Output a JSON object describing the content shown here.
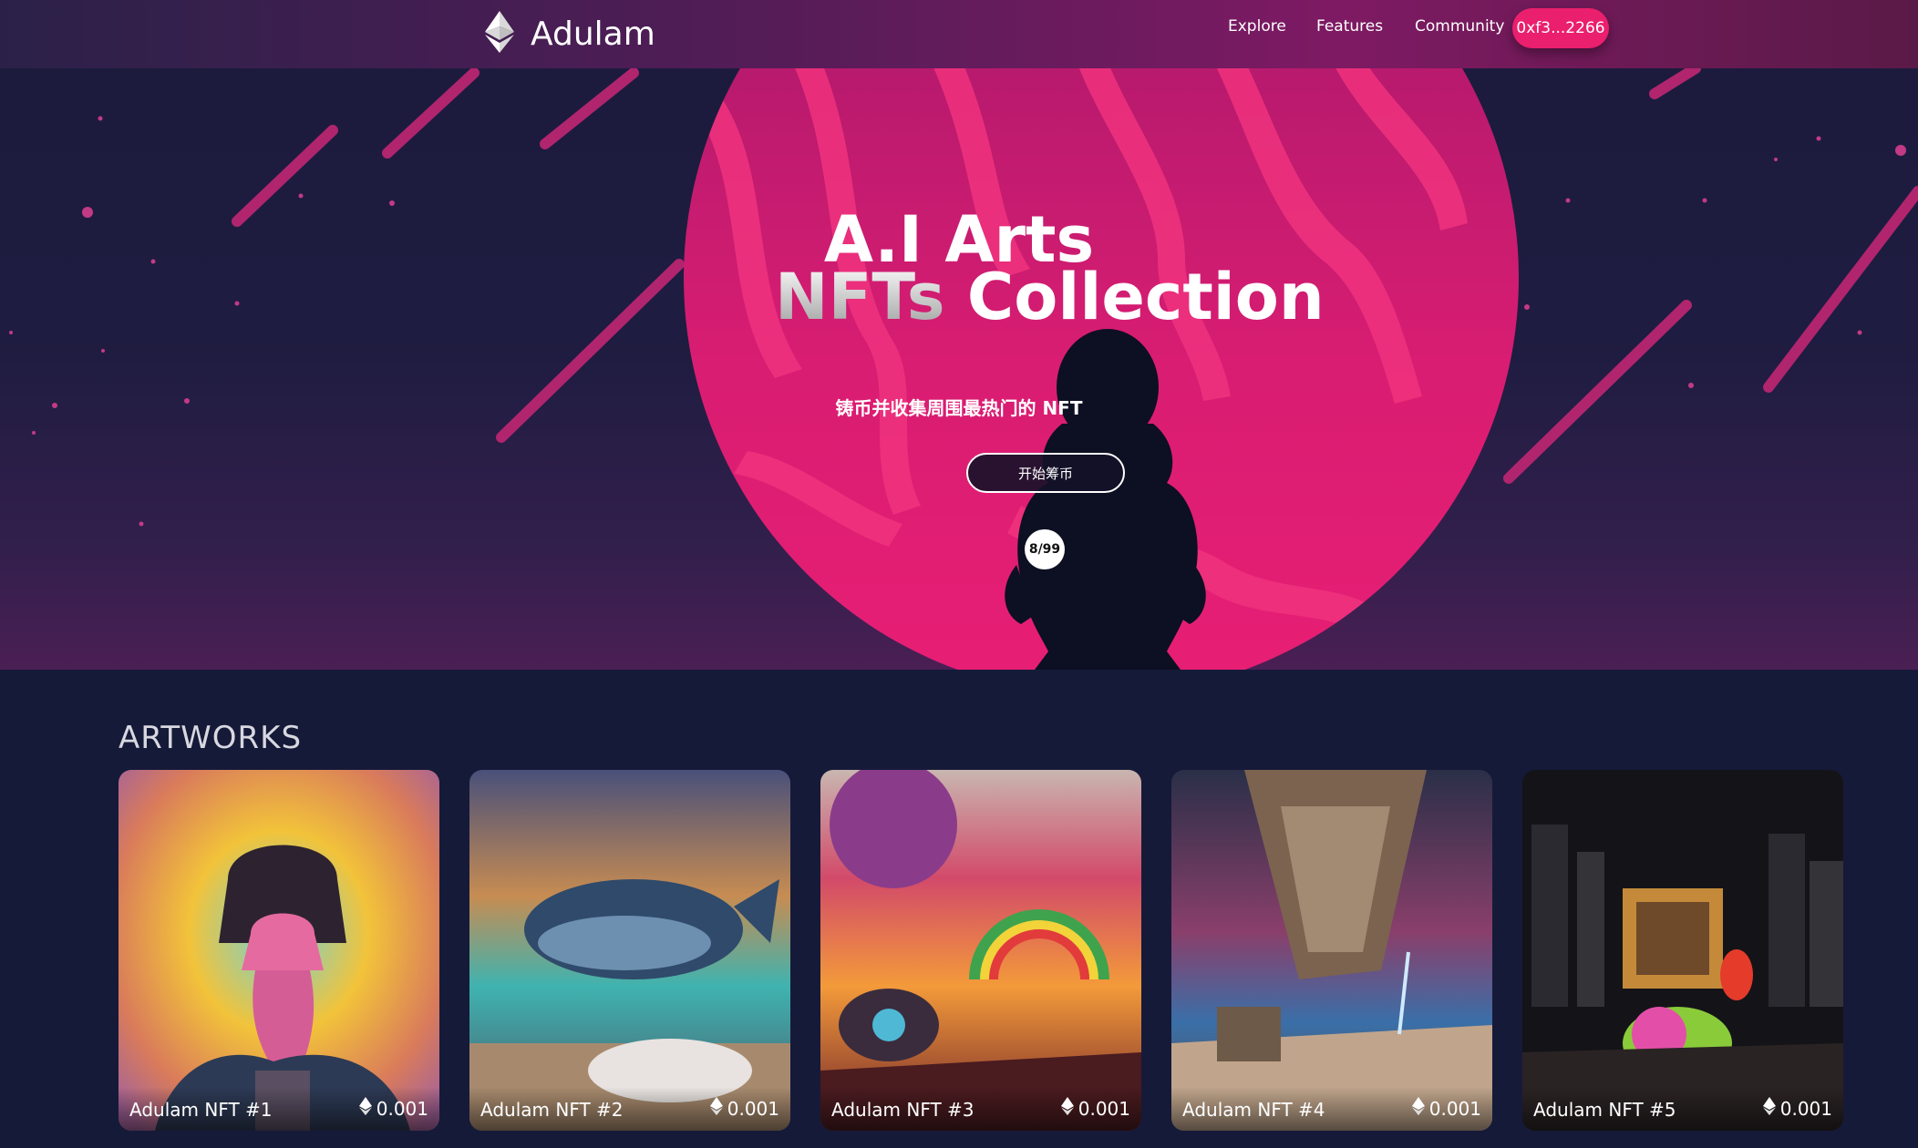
{
  "brand": {
    "name": "Adulam",
    "logo_icon": "ethereum-icon"
  },
  "nav": {
    "links": [
      "Explore",
      "Features",
      "Community"
    ],
    "wallet_label": "0xf3...2266"
  },
  "hero": {
    "title_line1": "A.I Arts",
    "title_line2_highlight": "NFTs",
    "title_line2_rest": "Collection",
    "subtitle": "铸币并收集周围最热门的 NFT",
    "mint_button": "开始筹币",
    "minted_counter": "8/99",
    "colors": {
      "planet": "#e61c73",
      "background": "#1c1b3e",
      "meteor": "#b0256e"
    }
  },
  "artworks": {
    "heading": "ARTWORKS",
    "items": [
      {
        "name": "Adulam NFT #1",
        "price": "0.001",
        "price_icon": "ethereum-icon"
      },
      {
        "name": "Adulam NFT #2",
        "price": "0.001",
        "price_icon": "ethereum-icon"
      },
      {
        "name": "Adulam NFT #3",
        "price": "0.001",
        "price_icon": "ethereum-icon"
      },
      {
        "name": "Adulam NFT #4",
        "price": "0.001",
        "price_icon": "ethereum-icon"
      },
      {
        "name": "Adulam NFT #5",
        "price": "0.001",
        "price_icon": "ethereum-icon"
      }
    ]
  }
}
